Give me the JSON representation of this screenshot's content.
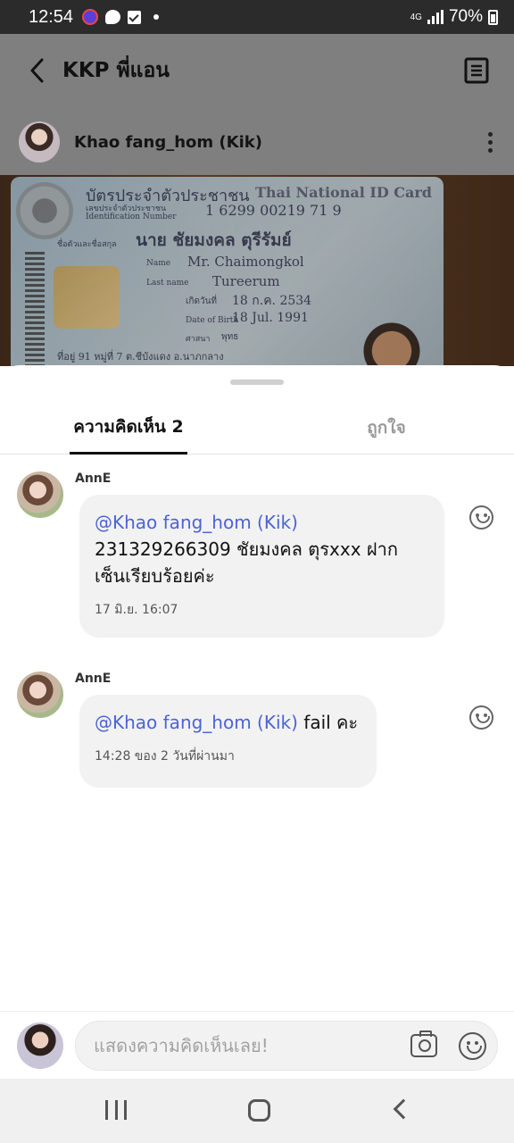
{
  "status_bar": {
    "time": "12:54",
    "network": "4G",
    "battery": "70%"
  },
  "header": {
    "title": "KKP พี่แอน"
  },
  "post": {
    "author": "Khao fang_hom (Kik)",
    "card_text": {
      "title_th": "บัตรประจำตัวประชาชน",
      "title_en": "Thai National ID Card",
      "id_label_th": "เลขประจำตัวประชาชน",
      "id_label_en": "Identification Number",
      "id_number": "1 6299 00219 71 9",
      "name_label_th": "ชื่อตัวและชื่อสกุล",
      "name_th": "นาย ชัยมงคล ตุรีรัมย์",
      "name_label": "Name",
      "name_en": "Mr. Chaimongkol",
      "last_name_label": "Last name",
      "last_name_en": "Tureerum",
      "dob_label_th": "เกิดวันที่",
      "dob_th": "18 ก.ค. 2534",
      "dob_label_en": "Date of Birth",
      "dob_en": "18 Jul. 1991",
      "religion_label": "ศาสนา",
      "religion": "พุทธ",
      "address": "ที่อยู่ 91 หมู่ที่ 7 ต.ชีบังแดง อ.นาภกลาง"
    }
  },
  "sheet": {
    "tabs": [
      {
        "label": "ความคิดเห็น 2",
        "active": true
      },
      {
        "label": "ถูกใจ",
        "active": false
      }
    ]
  },
  "comments": [
    {
      "name": "AnnE",
      "mention": "@Khao fang_hom (Kik)",
      "text": "231329266309 ชัยมงคล ตุรxxx ฝากเซ็นเรียบร้อยค่ะ",
      "time": "17 มิ.ย. 16:07"
    },
    {
      "name": "AnnE",
      "mention": "@Khao fang_hom (Kik)",
      "text": "fail คะ",
      "time": "14:28 ของ 2 วันที่ผ่านมา"
    }
  ],
  "compose": {
    "placeholder": "แสดงความคิดเห็นเลย!"
  },
  "icons": {
    "back": "chevron-left-icon",
    "menu": "document-menu-icon",
    "more": "vertical-dots-icon",
    "emoji": "smiley-icon",
    "camera": "camera-icon"
  },
  "colors": {
    "mention": "#4b63d6",
    "bubble": "#f2f2f2",
    "status_bar": "#2b2b2b"
  }
}
